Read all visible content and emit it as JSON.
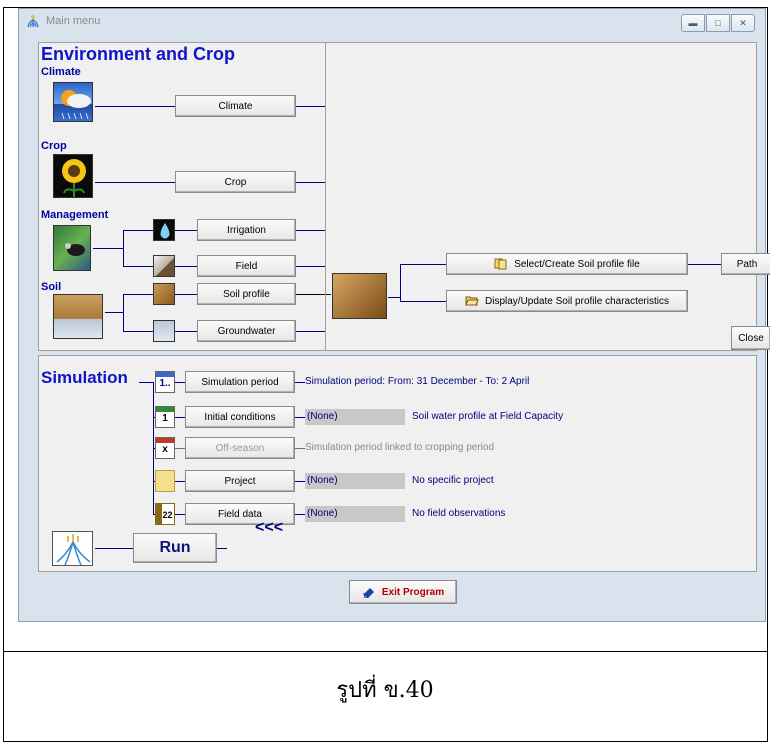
{
  "window": {
    "title": "Main menu",
    "controls": [
      "minimize",
      "maximize",
      "close"
    ]
  },
  "environment": {
    "heading": "Environment and Crop",
    "climate": {
      "label": "Climate",
      "button": "Climate"
    },
    "crop": {
      "label": "Crop",
      "button": "Crop"
    },
    "management": {
      "label": "Management",
      "irrigation_button": "Irrigation",
      "field_button": "Field"
    },
    "soil": {
      "label": "Soil",
      "soil_profile_button": "Soil profile",
      "groundwater_button": "Groundwater"
    }
  },
  "soil_panel": {
    "select_button": "Select/Create Soil profile file",
    "path_button": "Path",
    "display_button": "Display/Update Soil profile characteristics",
    "close_button": "Close"
  },
  "simulation": {
    "heading": "Simulation",
    "period": {
      "button": "Simulation period",
      "icon_text": "1..",
      "text": "Simulation period: From: 31 December  - To: 2 April"
    },
    "initial": {
      "button": "Initial conditions",
      "icon_text": "1",
      "value": "(None)",
      "text": "Soil water profile at Field Capacity"
    },
    "offseason": {
      "button": "Off-season",
      "icon_text": "x",
      "text": "Simulation period linked to cropping period"
    },
    "project": {
      "button": "Project",
      "value": "(None)",
      "text": "No specific project"
    },
    "field_data": {
      "button": "Field data",
      "icon_text": "22",
      "value": "(None)",
      "text": "No field observations"
    },
    "run_button": "Run",
    "run_arrows": "<<<"
  },
  "exit_button": "Exit Program",
  "caption": "รูปที่ ข.40",
  "colors": {
    "heading": "#1313c8",
    "connector": "#000080",
    "exit": "#b00000",
    "window_bg": "#d9e3ee",
    "panel_bg": "#f0f0f0"
  }
}
